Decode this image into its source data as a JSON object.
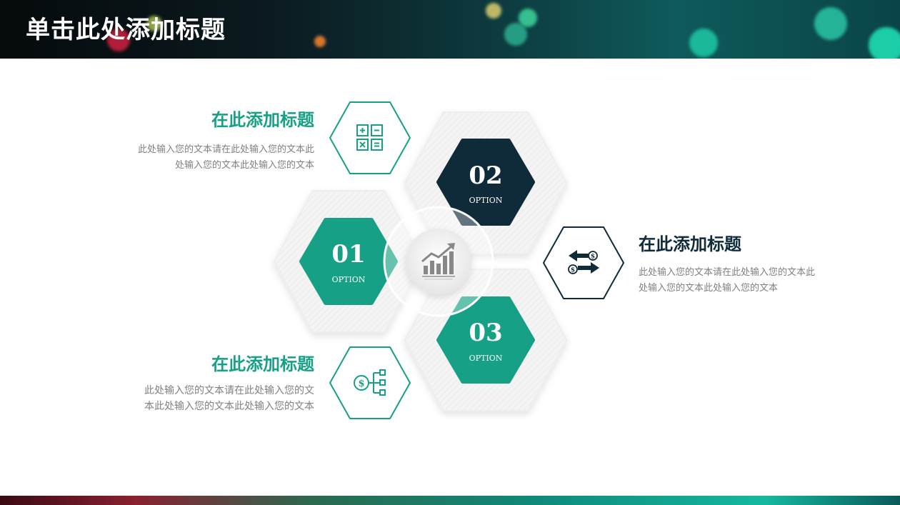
{
  "header": {
    "title": "单击此处添加标题"
  },
  "items": [
    {
      "title": "在此添加标题",
      "line1": "此处输入您的文本请在此处输入您的文本此",
      "line2": "处输入您的文本此处输入您的文本",
      "icon": "calculator-icon"
    },
    {
      "title": "在此添加标题",
      "line1": "此处输入您的文本请在此处输入您的文本此",
      "line2": "处输入您的文本此处输入您的文本",
      "icon": "currency-exchange-icon"
    },
    {
      "title": "在此添加标题",
      "line1": "此处输入您的文本请在此处输入您的文",
      "line2": "本此处输入您的文本此处输入您的文本",
      "icon": "money-flow-icon"
    }
  ],
  "hexes": [
    {
      "number": "01",
      "label": "OPTION"
    },
    {
      "number": "02",
      "label": "OPTION"
    },
    {
      "number": "03",
      "label": "OPTION"
    }
  ],
  "center_icon": "chart-growth-icon",
  "colors": {
    "green": "#16a085",
    "navy": "#0f2b3a",
    "gray_text": "#808080"
  }
}
